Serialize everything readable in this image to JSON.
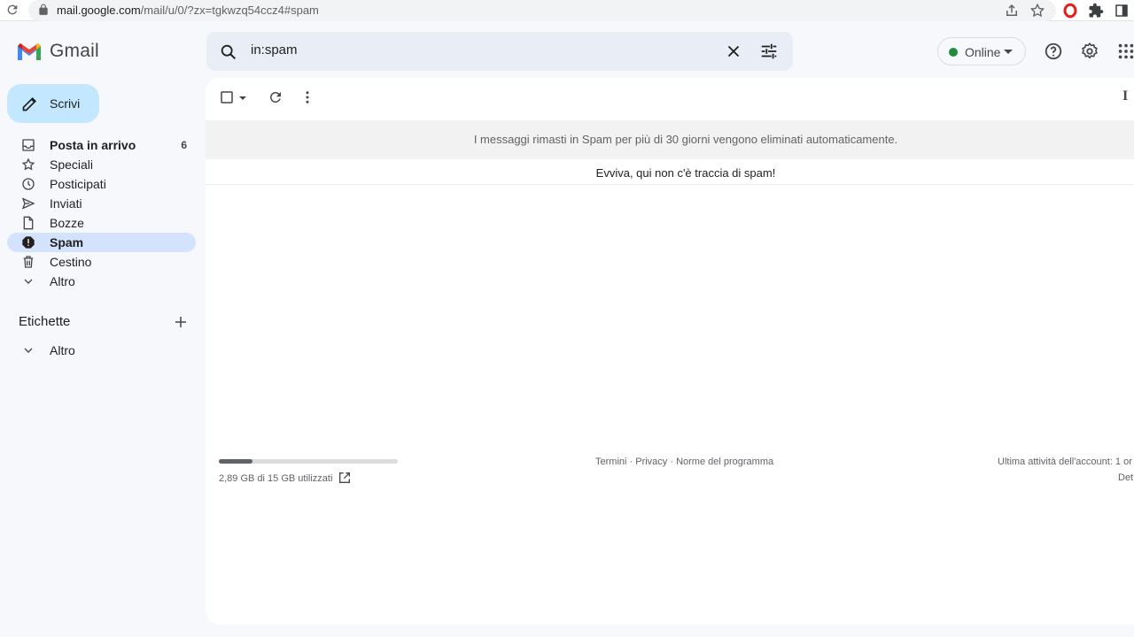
{
  "browser": {
    "url_host": "mail.google.com",
    "url_path": "/mail/u/0/?zx=tgkwzq54ccz4#spam"
  },
  "app": {
    "brand": "Gmail"
  },
  "search": {
    "value": "in:spam"
  },
  "status": {
    "label": "Online",
    "color": "#1e8e3e"
  },
  "compose": {
    "label": "Scrivi"
  },
  "nav": {
    "items": [
      {
        "label": "Posta in arrivo",
        "count": "6"
      },
      {
        "label": "Speciali"
      },
      {
        "label": "Posticipati"
      },
      {
        "label": "Inviati"
      },
      {
        "label": "Bozze"
      },
      {
        "label": "Spam"
      },
      {
        "label": "Cestino"
      },
      {
        "label": "Altro"
      }
    ],
    "active": "Spam"
  },
  "labels": {
    "heading": "Etichette",
    "more": "Altro"
  },
  "toolbar": {
    "sort_glyph": "I"
  },
  "main": {
    "banner": "I messaggi rimasti in Spam per più di 30 giorni vengono eliminati automaticamente.",
    "empty_message": "Evviva, qui non c'è traccia di spam!"
  },
  "footer": {
    "storage_text": "2,89 GB di 15 GB utilizzati",
    "storage_fraction": 0.19,
    "link_terms": "Termini",
    "sep": " · ",
    "link_privacy": "Privacy",
    "link_policies": "Norme del programma",
    "last_activity": "Ultima attività dell'account: 1 or",
    "details": "Det"
  },
  "colors": {
    "accent": "#c2e7ff",
    "active_nav": "#d3e3fd",
    "background": "#f6f8fc"
  }
}
